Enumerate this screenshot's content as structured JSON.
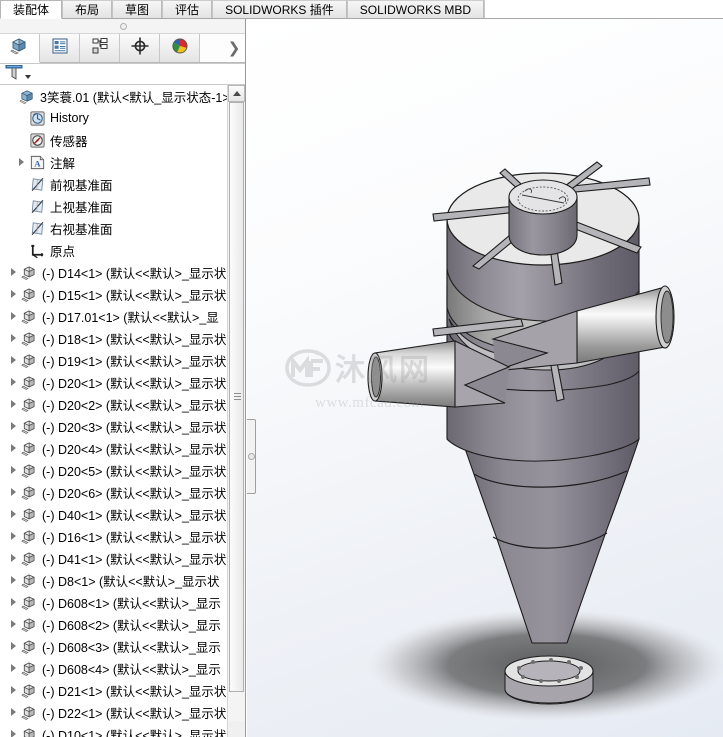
{
  "command_tabs": [
    {
      "label": "装配体",
      "active": true
    },
    {
      "label": "布局",
      "active": false
    },
    {
      "label": "草图",
      "active": false
    },
    {
      "label": "评估",
      "active": false
    },
    {
      "label": "SOLIDWORKS 插件",
      "active": false
    },
    {
      "label": "SOLIDWORKS MBD",
      "active": false
    }
  ],
  "panel_tabs": [
    {
      "name": "feature-manager-design-tree",
      "icon": "assembly-cube-icon",
      "active": true
    },
    {
      "name": "property-manager",
      "icon": "property-list-icon",
      "active": false
    },
    {
      "name": "configuration-manager",
      "icon": "configuration-icon",
      "active": false
    },
    {
      "name": "dimxpert-manager",
      "icon": "dimxpert-target-icon",
      "active": false
    },
    {
      "name": "display-manager",
      "icon": "display-sphere-icon",
      "active": false
    }
  ],
  "panel_overflow_label": "❯",
  "filter": {
    "icon": "filter-funnel-icon",
    "placeholder": ""
  },
  "tree": {
    "root": {
      "label": "3笑蓑.01  (默认<默认_显示状态-1>)",
      "icon": "assembly-cube-icon"
    },
    "fixed_items": [
      {
        "label": "History",
        "icon": "history-icon",
        "expandable": false
      },
      {
        "label": "传感器",
        "icon": "sensor-icon",
        "expandable": false
      },
      {
        "label": "注解",
        "icon": "annotations-icon",
        "expandable": true
      },
      {
        "label": "前视基准面",
        "icon": "plane-icon",
        "expandable": false
      },
      {
        "label": "上视基准面",
        "icon": "plane-icon",
        "expandable": false
      },
      {
        "label": "右视基准面",
        "icon": "plane-icon",
        "expandable": false
      },
      {
        "label": "原点",
        "icon": "origin-icon",
        "expandable": false
      }
    ],
    "components": [
      {
        "label": "(-) D14<1>  (默认<<默认>_显示状",
        "icon": "part-icon",
        "expandable": true
      },
      {
        "label": "(-) D15<1>  (默认<<默认>_显示状",
        "icon": "part-icon",
        "expandable": true
      },
      {
        "label": "(-) D17.01<1>  (默认<<默认>_显",
        "icon": "part-icon",
        "expandable": true
      },
      {
        "label": "(-) D18<1>  (默认<<默认>_显示状",
        "icon": "part-icon",
        "expandable": true
      },
      {
        "label": "(-) D19<1>  (默认<<默认>_显示状",
        "icon": "part-icon",
        "expandable": true
      },
      {
        "label": "(-) D20<1>  (默认<<默认>_显示状",
        "icon": "part-icon",
        "expandable": true
      },
      {
        "label": "(-) D20<2>  (默认<<默认>_显示状",
        "icon": "part-icon",
        "expandable": true
      },
      {
        "label": "(-) D20<3>  (默认<<默认>_显示状",
        "icon": "part-icon",
        "expandable": true
      },
      {
        "label": "(-) D20<4>  (默认<<默认>_显示状",
        "icon": "part-icon",
        "expandable": true
      },
      {
        "label": "(-) D20<5>  (默认<<默认>_显示状",
        "icon": "part-icon",
        "expandable": true
      },
      {
        "label": "(-) D20<6>  (默认<<默认>_显示状",
        "icon": "part-icon",
        "expandable": true
      },
      {
        "label": "(-) D40<1>  (默认<<默认>_显示状",
        "icon": "part-icon",
        "expandable": true
      },
      {
        "label": "(-) D16<1>  (默认<<默认>_显示状",
        "icon": "part-icon",
        "expandable": true
      },
      {
        "label": "(-) D41<1>  (默认<<默认>_显示状",
        "icon": "part-icon",
        "expandable": true
      },
      {
        "label": "(-) D8<1>  (默认<<默认>_显示状",
        "icon": "part-icon",
        "expandable": true
      },
      {
        "label": "(-) D608<1>  (默认<<默认>_显示",
        "icon": "part-icon",
        "expandable": true
      },
      {
        "label": "(-) D608<2>  (默认<<默认>_显示",
        "icon": "part-icon",
        "expandable": true
      },
      {
        "label": "(-) D608<3>  (默认<<默认>_显示",
        "icon": "part-icon",
        "expandable": true
      },
      {
        "label": "(-) D608<4>  (默认<<默认>_显示",
        "icon": "part-icon",
        "expandable": true
      },
      {
        "label": "(-) D21<1>  (默认<<默认>_显示状",
        "icon": "part-icon",
        "expandable": true
      },
      {
        "label": "(-) D22<1>  (默认<<默认>_显示状",
        "icon": "part-icon",
        "expandable": true
      },
      {
        "label": "(-) D10<1>  (默认<<默认>_显示状",
        "icon": "part-icon",
        "expandable": true
      }
    ]
  },
  "watermark": {
    "cn_text": "沐风网",
    "url_text": "www.mfcad.com",
    "logo": "mf-logo-icon"
  },
  "model": {
    "name": "cyclone-separator-assembly",
    "description": "旋风分离器装配体 3D 模型"
  },
  "colors": {
    "tab_active_bg": "#ffffff",
    "tab_inactive_bg": "#e8e8e8",
    "panel_bg": "#ffffff",
    "viewport_top": "#ffffff",
    "viewport_bottom": "#e6ebf3",
    "model_light": "#e8e8e8",
    "model_mid": "#9a9aa0",
    "model_dark": "#6f6b74",
    "shadow": "#4a4a4a"
  }
}
